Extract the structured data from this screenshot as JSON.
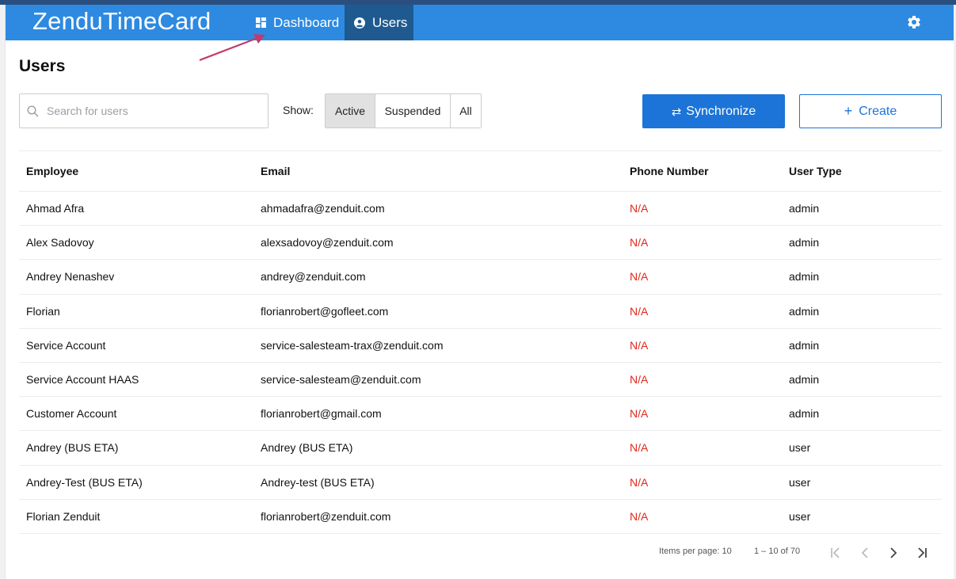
{
  "app": {
    "brand": "ZenduTimeCard",
    "nav": [
      {
        "label": "Dashboard",
        "icon": "dashboard-icon"
      },
      {
        "label": "Users",
        "icon": "account-circle-icon",
        "active": true
      }
    ],
    "settings_icon": "gear-icon",
    "accent_color": "#2d8ae0"
  },
  "page": {
    "title": "Users",
    "search_placeholder": "Search for users",
    "show_label": "Show:",
    "filters": [
      "Active",
      "Suspended",
      "All"
    ],
    "active_filter": "Active",
    "sync_label": "Synchronize",
    "create_label": "Create"
  },
  "table": {
    "headers": [
      "Employee",
      "Email",
      "Phone Number",
      "User Type"
    ],
    "rows": [
      [
        "Ahmad Afra",
        "ahmadafra@zenduit.com",
        "N/A",
        "admin"
      ],
      [
        "Alex Sadovoy",
        "alexsadovoy@zenduit.com",
        "N/A",
        "admin"
      ],
      [
        "Andrey Nenashev",
        "andrey@zenduit.com",
        "N/A",
        "admin"
      ],
      [
        "Florian",
        "florianrobert@gofleet.com",
        "N/A",
        "admin"
      ],
      [
        "Service Account",
        "service-salesteam-trax@zenduit.com",
        "N/A",
        "admin"
      ],
      [
        "Service Account HAAS",
        "service-salesteam@zenduit.com",
        "N/A",
        "admin"
      ],
      [
        "Customer Account",
        "florianrobert@gmail.com",
        "N/A",
        "admin"
      ],
      [
        "Andrey (BUS ETA)",
        "Andrey (BUS ETA)",
        "N/A",
        "user"
      ],
      [
        "Andrey-Test (BUS ETA)",
        "Andrey-test (BUS ETA)",
        "N/A",
        "user"
      ],
      [
        "Florian Zenduit",
        "florianrobert@zenduit.com",
        "N/A",
        "user"
      ]
    ]
  },
  "pagination": {
    "items_per_page": "Items per page: 10",
    "range": "1 – 10 of 70"
  }
}
